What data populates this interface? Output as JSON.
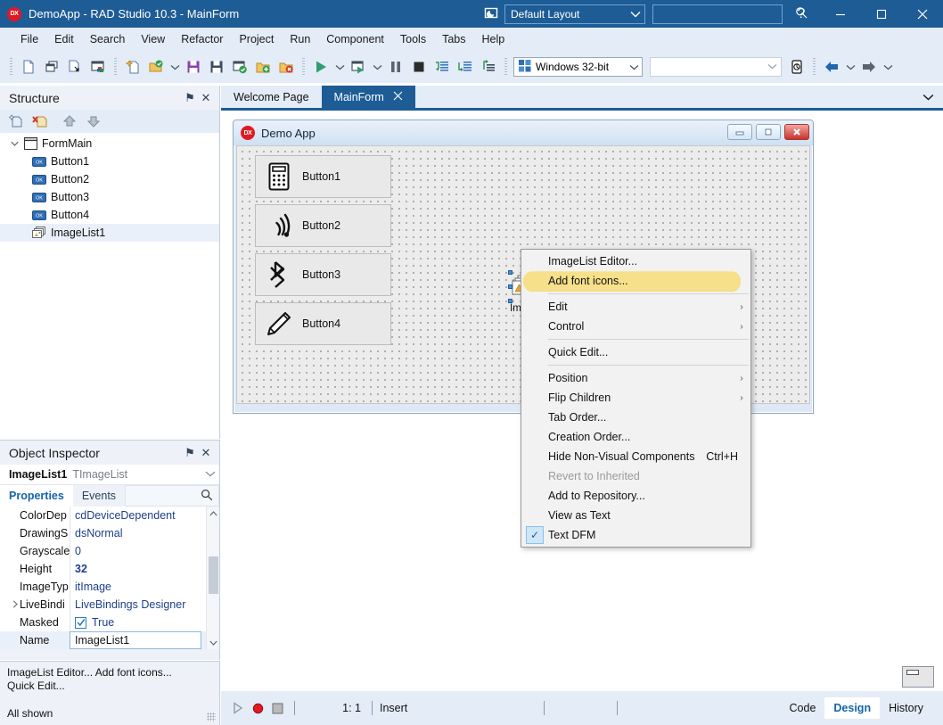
{
  "titlebar": {
    "logo_text": "DX",
    "title": "DemoApp - RAD Studio 10.3 - MainForm",
    "layout_value": "Default Layout",
    "search_placeholder": "",
    "search_value": "",
    "help_label": "?",
    "minimize_label": "─",
    "maximize_label": "☐",
    "close_label": "✕",
    "bg_color": "#1e5c96"
  },
  "menubar": {
    "items": [
      {
        "label": "File"
      },
      {
        "label": "Edit"
      },
      {
        "label": "Search"
      },
      {
        "label": "View"
      },
      {
        "label": "Refactor"
      },
      {
        "label": "Project"
      },
      {
        "label": "Run"
      },
      {
        "label": "Component"
      },
      {
        "label": "Tools"
      },
      {
        "label": "Tabs"
      },
      {
        "label": "Help"
      }
    ]
  },
  "toolbar": {
    "platform_value": "Windows 32-bit",
    "config_value": ""
  },
  "structure": {
    "title": "Structure",
    "pin_label": "⚑",
    "close_label": "✕",
    "tree": [
      {
        "label": "FormMain",
        "level": 0,
        "icon": "form-icon",
        "expanded": true,
        "selected": false
      },
      {
        "label": "Button1",
        "level": 1,
        "icon": "button-icon",
        "selected": false
      },
      {
        "label": "Button2",
        "level": 1,
        "icon": "button-icon",
        "selected": false
      },
      {
        "label": "Button3",
        "level": 1,
        "icon": "button-icon",
        "selected": false
      },
      {
        "label": "Button4",
        "level": 1,
        "icon": "button-icon",
        "selected": false
      },
      {
        "label": "ImageList1",
        "level": 1,
        "icon": "imagelist-icon",
        "selected": true
      }
    ]
  },
  "inspector": {
    "title": "Object Inspector",
    "pin_label": "⚑",
    "close_label": "✕",
    "object_name": "ImageList1",
    "object_type": "TImageList",
    "tabs": [
      {
        "label": "Properties",
        "active": true
      },
      {
        "label": "Events",
        "active": false
      }
    ],
    "rows": [
      {
        "key": "ColorDep",
        "value": "cdDeviceDependent",
        "kind": "text"
      },
      {
        "key": "DrawingS",
        "value": "dsNormal",
        "kind": "text"
      },
      {
        "key": "Grayscale",
        "value": "0",
        "kind": "text"
      },
      {
        "key": "Height",
        "value": "32",
        "kind": "bold"
      },
      {
        "key": "ImageTyp",
        "value": "itImage",
        "kind": "text"
      },
      {
        "key": "LiveBindi",
        "value": "LiveBindings Designer",
        "kind": "text",
        "expandable": true
      },
      {
        "key": "Masked",
        "value": "True",
        "kind": "checkbox",
        "checked": true
      },
      {
        "key": "Name",
        "value": "ImageList1",
        "kind": "editing",
        "selected": true
      }
    ]
  },
  "hint_panel": {
    "line1": "ImageList Editor...  Add font icons...",
    "line2": "Quick Edit...",
    "status": "All shown"
  },
  "doctabs": {
    "tabs": [
      {
        "label": "Welcome Page",
        "active": false,
        "closable": false
      },
      {
        "label": "MainForm",
        "active": true,
        "closable": true,
        "close_label": "✕"
      }
    ],
    "overflow_chevron": "⌄"
  },
  "designer": {
    "form": {
      "logo_text": "DX",
      "caption": "Demo App",
      "minimize_label": "─",
      "maximize_label": "□",
      "close_label": "x"
    },
    "buttons": [
      {
        "label": "Button1",
        "icon": "calculator-icon"
      },
      {
        "label": "Button2",
        "icon": "wifi-icon"
      },
      {
        "label": "Button3",
        "icon": "bluetooth-icon"
      },
      {
        "label": "Button4",
        "icon": "pencil-icon"
      }
    ],
    "imagelist_component": {
      "caption": "ImageList1",
      "selected": true
    }
  },
  "context_menu": {
    "items": [
      {
        "label": "ImageList Editor...",
        "accel": "m",
        "type": "item"
      },
      {
        "label": "Add font icons...",
        "accel": "i",
        "type": "item",
        "highlighted": true
      },
      {
        "type": "separator"
      },
      {
        "label": "Edit",
        "accel": "E",
        "type": "submenu",
        "arrow": "›"
      },
      {
        "label": "Control",
        "accel": "C",
        "type": "submenu",
        "arrow": "›"
      },
      {
        "type": "separator"
      },
      {
        "label": "Quick Edit...",
        "accel": "Q",
        "type": "item"
      },
      {
        "type": "separator"
      },
      {
        "label": "Position",
        "accel": "P",
        "type": "submenu",
        "arrow": "›"
      },
      {
        "label": "Flip Children",
        "accel": "h",
        "type": "submenu",
        "arrow": "›"
      },
      {
        "label": "Tab Order...",
        "accel": "O",
        "type": "item"
      },
      {
        "label": "Creation Order...",
        "accel": "n",
        "type": "item"
      },
      {
        "label": "Hide Non-Visual Components",
        "shortcut": "Ctrl+H",
        "accel": "d",
        "type": "item"
      },
      {
        "label": "Revert to Inherited",
        "accel": "t",
        "type": "item",
        "disabled": true
      },
      {
        "label": "Add to Repository...",
        "accel": "R",
        "type": "item"
      },
      {
        "label": "View as Text",
        "accel": "V",
        "type": "item"
      },
      {
        "label": "Text DFM",
        "accel": "x",
        "type": "item",
        "checked": true,
        "check_label": "✓"
      }
    ],
    "highlight_color": "#f6e08a"
  },
  "status_bar": {
    "position": "1:  1",
    "mode": "Insert",
    "view_tabs": [
      {
        "label": "Code",
        "active": false
      },
      {
        "label": "Design",
        "active": true
      },
      {
        "label": "History",
        "active": false
      }
    ]
  }
}
